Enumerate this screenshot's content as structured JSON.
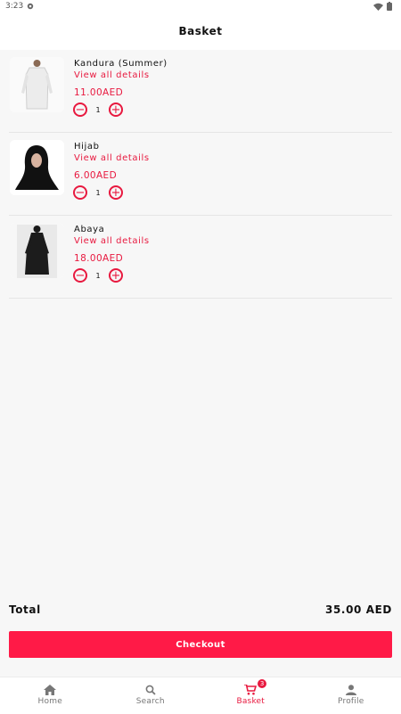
{
  "status": {
    "time": "3:23"
  },
  "appbar": {
    "title": "Basket"
  },
  "items": [
    {
      "name": "Kandura (Summer)",
      "details_label": "View all details",
      "price": "11.00AED",
      "qty": "1"
    },
    {
      "name": "Hijab",
      "details_label": "View all details",
      "price": "6.00AED",
      "qty": "1"
    },
    {
      "name": "Abaya",
      "details_label": "View all details",
      "price": "18.00AED",
      "qty": "1"
    }
  ],
  "summary": {
    "total_label": "Total",
    "total_value": "35.00 AED"
  },
  "checkout": {
    "label": "Checkout"
  },
  "nav": {
    "home": "Home",
    "search": "Search",
    "basket": "Basket",
    "basket_badge": "3",
    "profile": "Profile"
  },
  "colors": {
    "accent": "#e8193f",
    "button": "#ff1a47"
  }
}
